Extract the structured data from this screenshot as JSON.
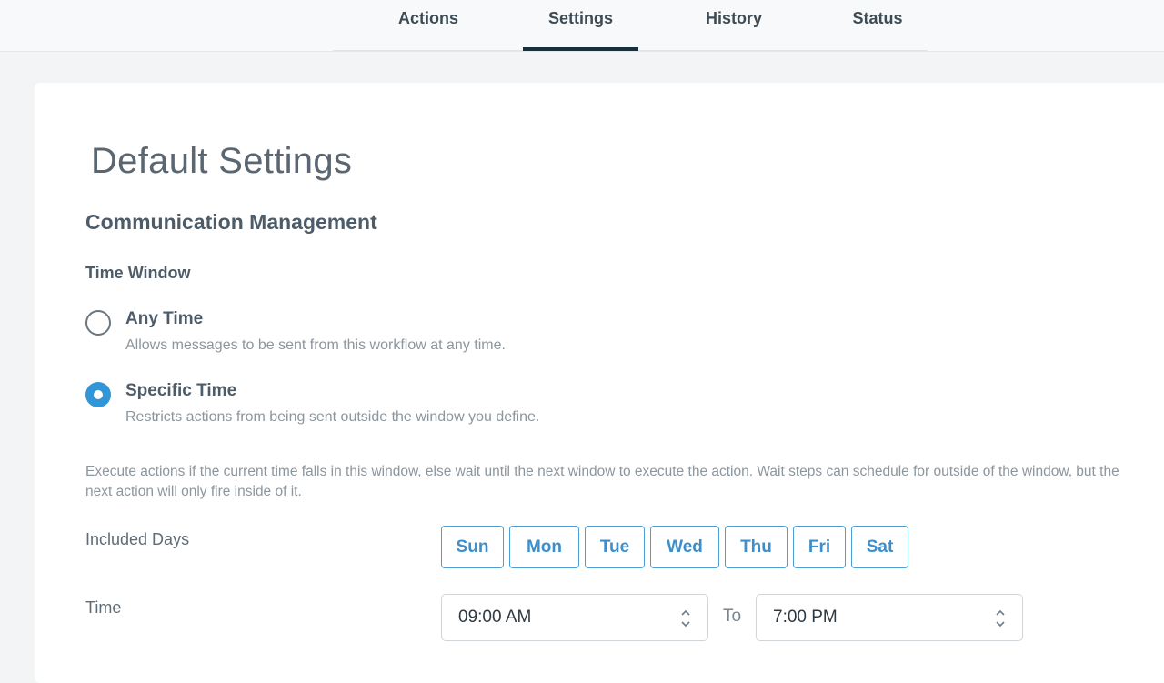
{
  "tabs": [
    {
      "label": "Actions"
    },
    {
      "label": "Settings"
    },
    {
      "label": "History"
    },
    {
      "label": "Status"
    }
  ],
  "active_tab": "Settings",
  "page": {
    "title": "Default Settings",
    "section_title": "Communication Management",
    "time_window": {
      "title": "Time Window",
      "options": [
        {
          "label": "Any Time",
          "description": "Allows messages to be sent from this workflow at any time.",
          "selected": false
        },
        {
          "label": "Specific Time",
          "description": "Restricts actions from being sent outside the window you define.",
          "selected": true
        }
      ]
    },
    "help_text": "Execute actions if the current time falls in this window, else wait until the next window to execute the action. Wait steps can schedule for outside of the window, but the next action will only fire inside of it.",
    "included_days": {
      "label": "Included Days",
      "days": [
        "Sun",
        "Mon",
        "Tue",
        "Wed",
        "Thu",
        "Fri",
        "Sat"
      ]
    },
    "time": {
      "label": "Time",
      "from": "09:00 AM",
      "to_label": "To",
      "to": "7:00 PM"
    }
  },
  "colors": {
    "accent": "#3195d6",
    "active_tab_underline": "#15303f",
    "day_button_border": "#4b9ed6"
  }
}
